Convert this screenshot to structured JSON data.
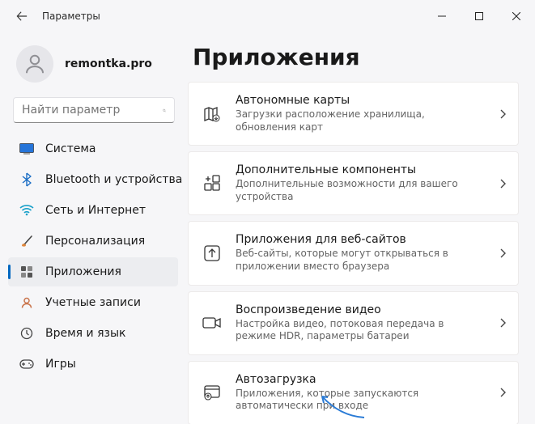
{
  "window": {
    "title": "Параметры"
  },
  "profile": {
    "name": "remontka.pro"
  },
  "search": {
    "placeholder": "Найти параметр"
  },
  "nav": [
    {
      "label": "Система"
    },
    {
      "label": "Bluetooth и устройства"
    },
    {
      "label": "Сеть и Интернет"
    },
    {
      "label": "Персонализация"
    },
    {
      "label": "Приложения"
    },
    {
      "label": "Учетные записи"
    },
    {
      "label": "Время и язык"
    },
    {
      "label": "Игры"
    }
  ],
  "page": {
    "title": "Приложения"
  },
  "cards": [
    {
      "title": "Автономные карты",
      "desc": "Загрузки расположение хранилища, обновления карт"
    },
    {
      "title": "Дополнительные компоненты",
      "desc": "Дополнительные возможности для вашего устройства"
    },
    {
      "title": "Приложения для веб-сайтов",
      "desc": "Веб-сайты, которые могут открываться в приложении вместо браузера"
    },
    {
      "title": "Воспроизведение видео",
      "desc": "Настройка видео, потоковая передача в режиме HDR, параметры батареи"
    },
    {
      "title": "Автозагрузка",
      "desc": "Приложения, которые запускаются автоматически при входе"
    }
  ]
}
